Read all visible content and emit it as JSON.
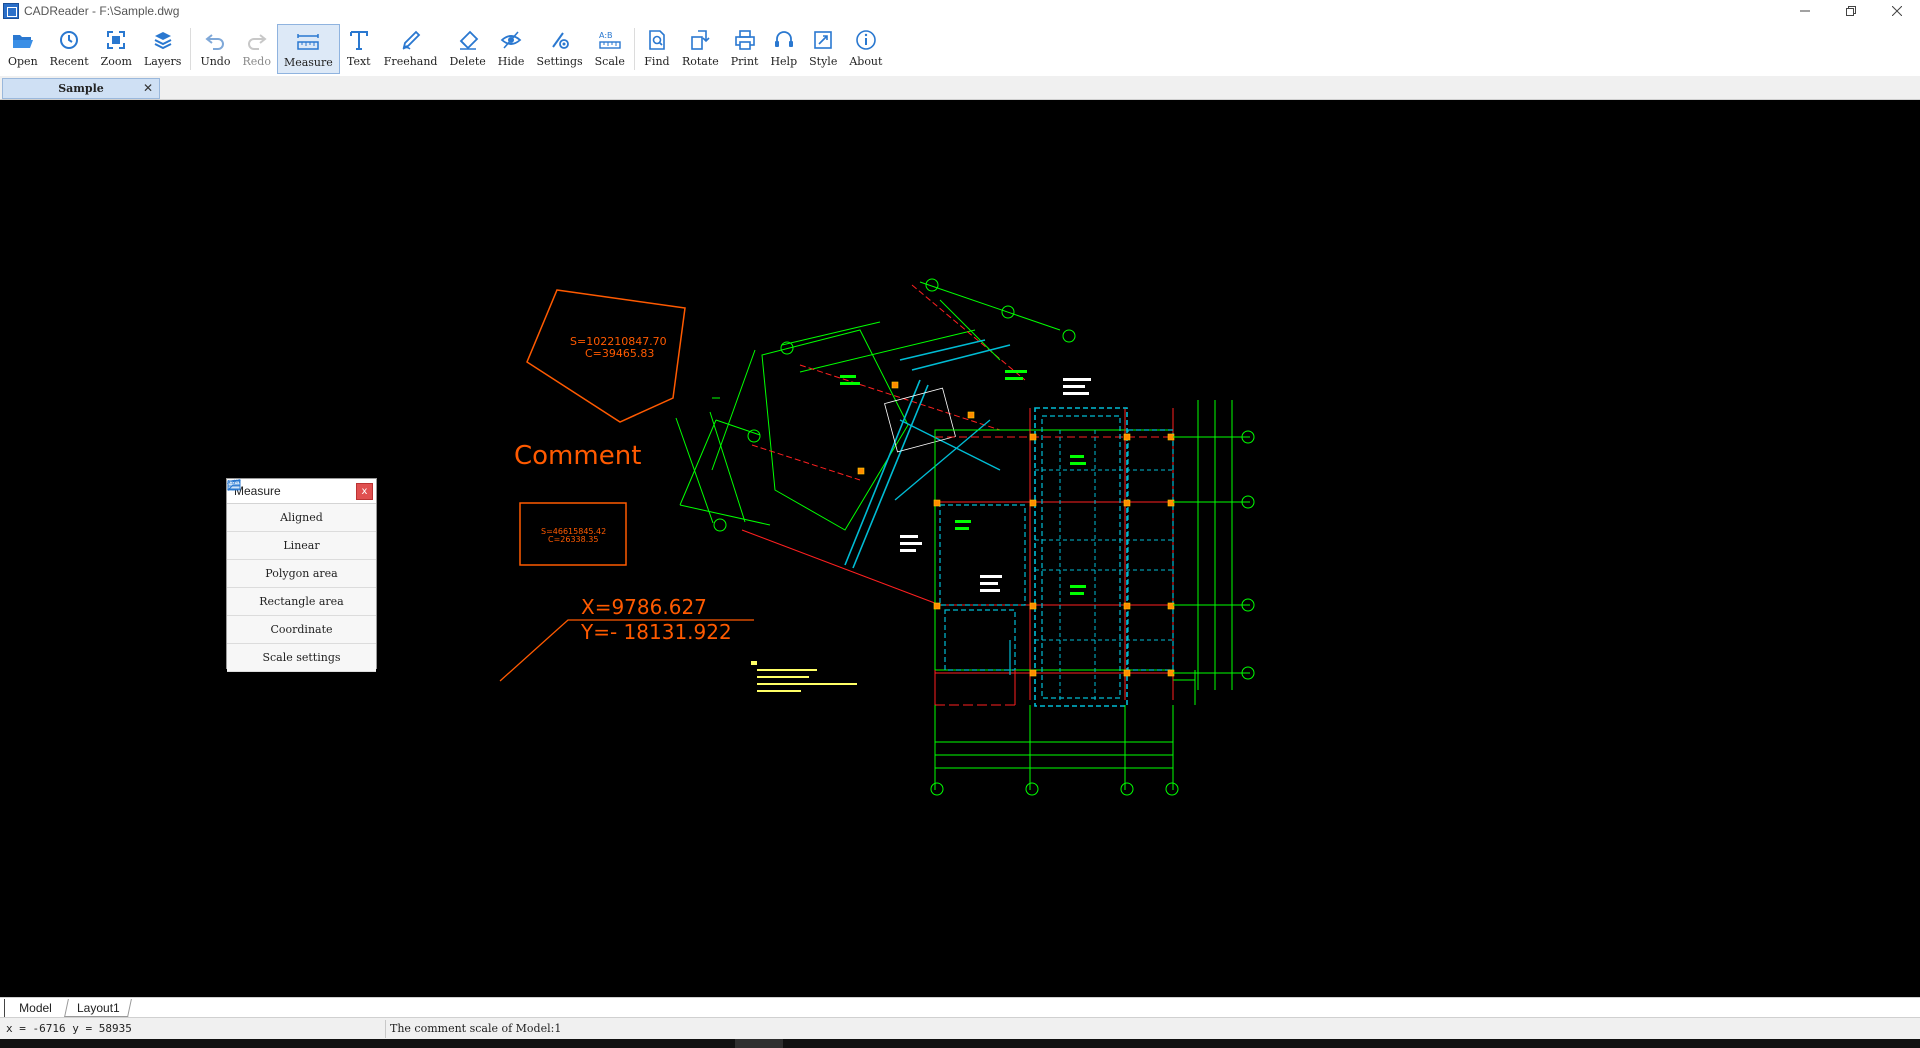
{
  "window": {
    "title": "CADReader - F:\\Sample.dwg",
    "controls": [
      "minimize",
      "restore",
      "close"
    ]
  },
  "toolbar": {
    "items": [
      {
        "label": "Open",
        "icon": "folder-open-icon"
      },
      {
        "label": "Recent",
        "icon": "clock-icon"
      },
      {
        "label": "Zoom",
        "icon": "zoom-extents-icon"
      },
      {
        "label": "Layers",
        "icon": "layers-icon"
      },
      {
        "label": "Undo",
        "icon": "undo-icon"
      },
      {
        "label": "Redo",
        "icon": "redo-icon",
        "disabled": true
      },
      {
        "label": "Measure",
        "icon": "measure-icon",
        "active": true
      },
      {
        "label": "Text",
        "icon": "text-icon"
      },
      {
        "label": "Freehand",
        "icon": "pen-icon"
      },
      {
        "label": "Delete",
        "icon": "eraser-icon"
      },
      {
        "label": "Hide",
        "icon": "eye-icon"
      },
      {
        "label": "Settings",
        "icon": "settings-icon"
      },
      {
        "label": "Scale",
        "icon": "scale-icon"
      },
      {
        "label": "Find",
        "icon": "find-icon"
      },
      {
        "label": "Rotate",
        "icon": "rotate-icon"
      },
      {
        "label": "Print",
        "icon": "printer-icon"
      },
      {
        "label": "Help",
        "icon": "headset-icon"
      },
      {
        "label": "Style",
        "icon": "style-icon"
      },
      {
        "label": "About",
        "icon": "info-icon"
      }
    ]
  },
  "doc_tab": {
    "label": "Sample",
    "close": "✕"
  },
  "measure_panel": {
    "title": "Measure",
    "close": "x",
    "items": [
      {
        "label": "Aligned",
        "icon": "aligned-icon"
      },
      {
        "label": "Linear",
        "icon": "linear-icon"
      },
      {
        "label": "Polygon area",
        "icon": "polygon-area-icon"
      },
      {
        "label": "Rectangle area",
        "icon": "rectangle-area-icon"
      },
      {
        "label": "Coordinate",
        "icon": "coordinate-icon"
      },
      {
        "label": "Scale settings",
        "icon": "scale-settings-icon"
      }
    ]
  },
  "drawing": {
    "polygon_area": "S=102210847.70",
    "polygon_perimeter": "C=39465.83",
    "comment": "Comment",
    "rect_area": "S=46615845.42",
    "rect_perimeter": "C=26338.35",
    "coord_x": "X=9786.627",
    "coord_y": "Y=- 18131.922",
    "annotation_color": "#ff5a00",
    "grid_color": "#00ff00",
    "beam_color": "#00bcd4",
    "axis_color": "#ff2020",
    "note_color": "#ffff66"
  },
  "layout_tabs": {
    "model": "Model",
    "layout1": "Layout1"
  },
  "status": {
    "coords": "x = -6716 y = 58935",
    "message": "The comment scale of Model:1"
  }
}
